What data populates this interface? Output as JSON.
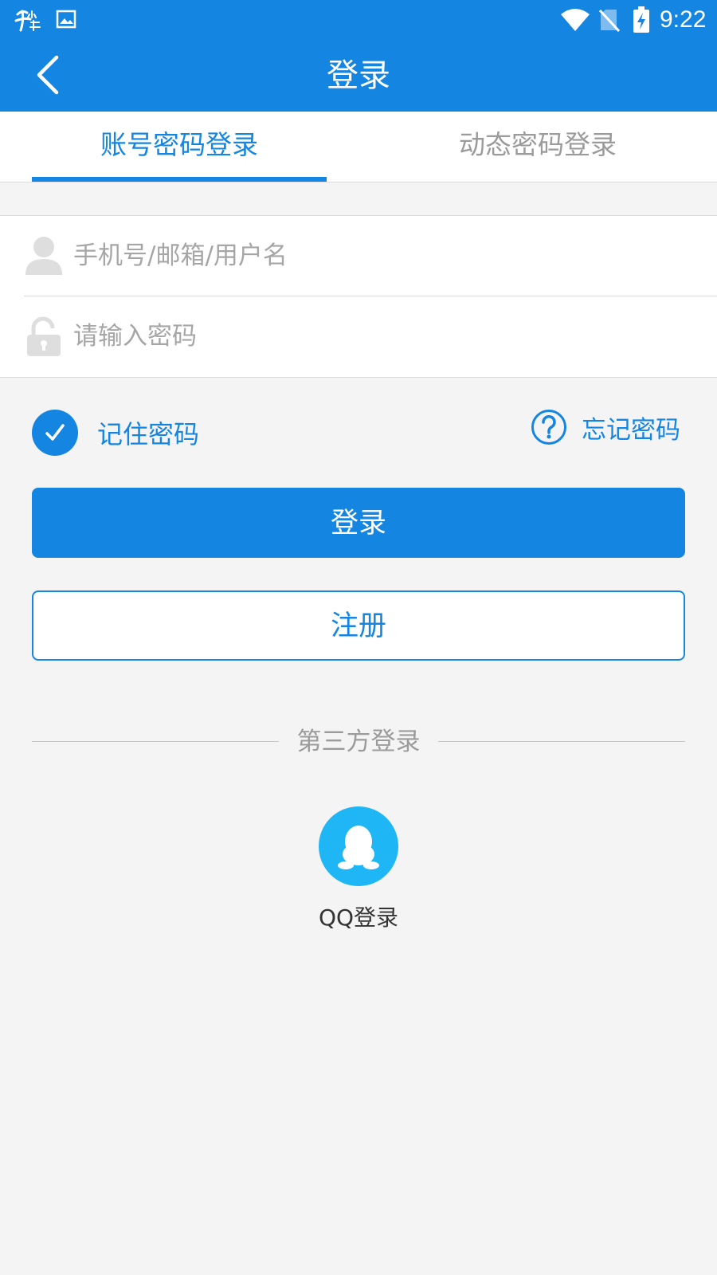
{
  "status_bar": {
    "time": "9:22",
    "icons": [
      "app-logo-icon",
      "image-icon",
      "wifi-icon",
      "no-sim-icon",
      "battery-charging-icon"
    ]
  },
  "app_bar": {
    "title": "登录",
    "back_icon": "chevron-left-icon"
  },
  "tabs": [
    {
      "label": "账号密码登录",
      "active": true
    },
    {
      "label": "动态密码登录",
      "active": false
    }
  ],
  "form": {
    "username": {
      "value": "",
      "placeholder": "手机号/邮箱/用户名",
      "icon": "user-icon"
    },
    "password": {
      "value": "",
      "placeholder": "请输入密码",
      "icon": "unlock-icon"
    }
  },
  "options": {
    "remember_label": "记住密码",
    "remember_checked": true,
    "forgot_label": "忘记密码",
    "forgot_icon": "question-circle-icon"
  },
  "buttons": {
    "login_label": "登录",
    "register_label": "注册"
  },
  "third_party": {
    "title": "第三方登录",
    "qq_label": "QQ登录",
    "qq_icon": "qq-penguin-icon"
  },
  "colors": {
    "primary": "#1585e2",
    "qq": "#1fb6f6",
    "background": "#f4f4f4"
  }
}
